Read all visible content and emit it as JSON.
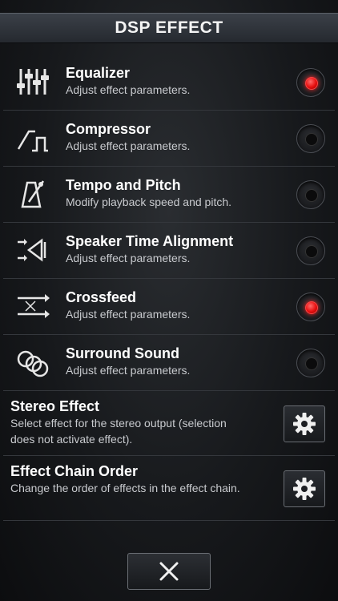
{
  "header": {
    "title": "DSP EFFECT"
  },
  "effects": [
    {
      "title": "Equalizer",
      "subtitle": "Adjust effect parameters.",
      "icon": "equalizer-sliders-icon",
      "enabled": true
    },
    {
      "title": "Compressor",
      "subtitle": "Adjust effect parameters.",
      "icon": "compressor-curve-icon",
      "enabled": false
    },
    {
      "title": "Tempo and Pitch",
      "subtitle": "Modify playback speed and pitch.",
      "icon": "metronome-icon",
      "enabled": false
    },
    {
      "title": "Speaker Time Alignment",
      "subtitle": "Adjust effect parameters.",
      "icon": "speaker-alignment-icon",
      "enabled": false
    },
    {
      "title": "Crossfeed",
      "subtitle": "Adjust effect parameters.",
      "icon": "crossfeed-arrows-icon",
      "enabled": true
    },
    {
      "title": "Surround Sound",
      "subtitle": "Adjust effect parameters.",
      "icon": "surround-rings-icon",
      "enabled": false
    }
  ],
  "settings": [
    {
      "title": "Stereo Effect",
      "subtitle": "Select effect for the stereo output (selection does not activate effect).",
      "icon": "gear-icon"
    },
    {
      "title": "Effect Chain Order",
      "subtitle": "Change the order of effects in the effect chain.",
      "icon": "gear-icon"
    }
  ],
  "footer": {
    "icon": "close-icon"
  },
  "colors": {
    "active": "#e81010",
    "background": "#17191c",
    "header": "#2f3339"
  }
}
